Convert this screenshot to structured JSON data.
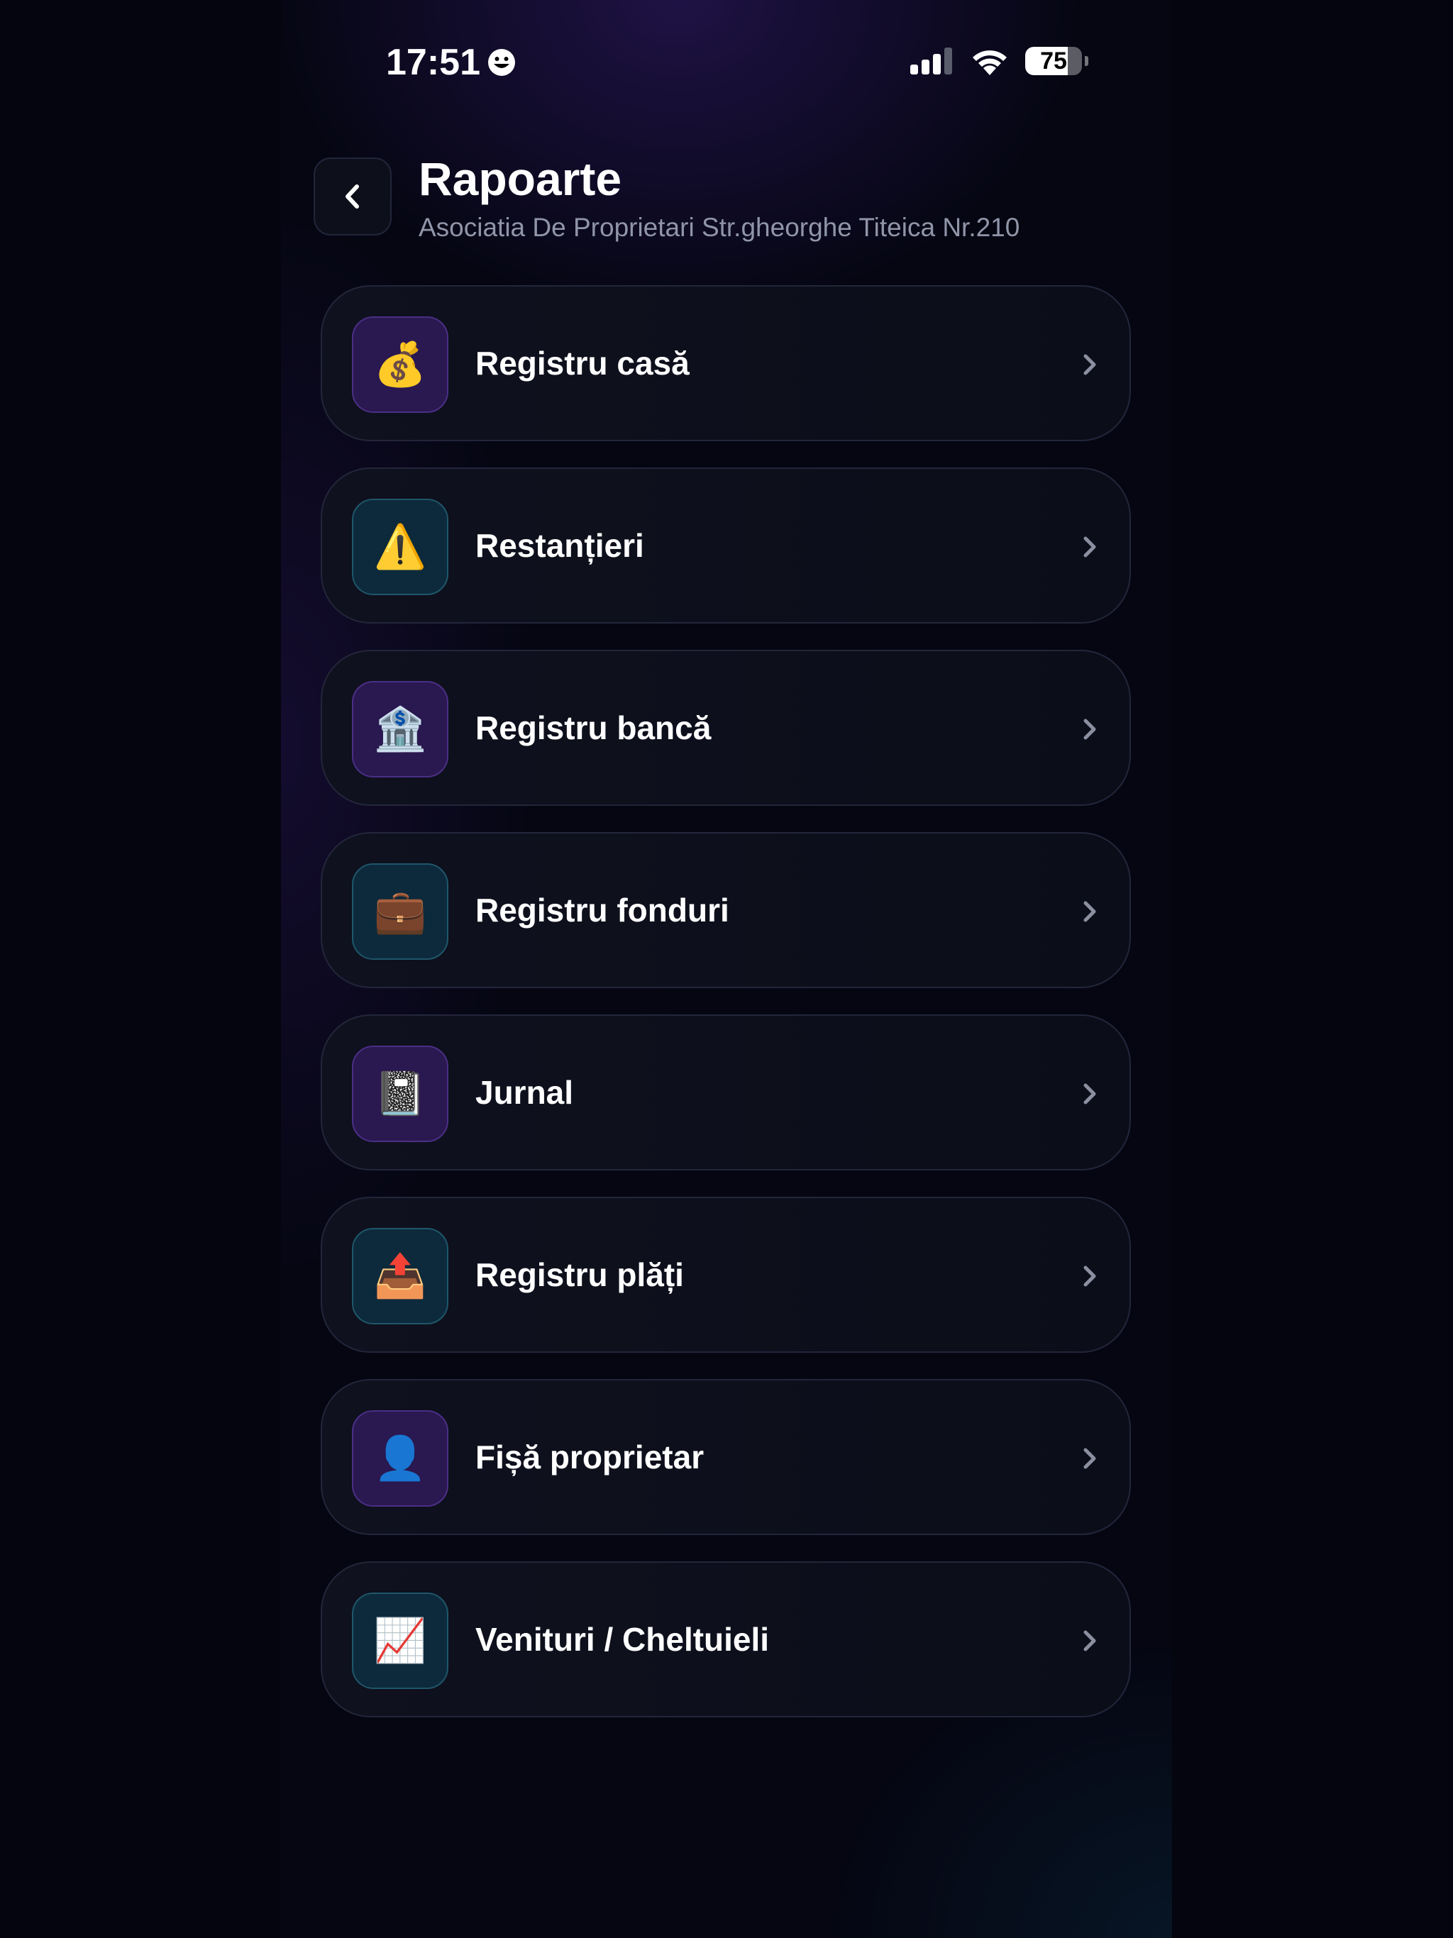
{
  "status_bar": {
    "time": "17:51",
    "battery_percent": "75",
    "battery_level": 0.75,
    "icons": [
      "smiley-face-icon",
      "cellular-signal-icon",
      "wifi-icon",
      "battery-icon"
    ]
  },
  "header": {
    "title": "Rapoarte",
    "subtitle": "Asociatia De Proprietari Str.gheorghe Titeica Nr.210",
    "back_icon": "chevron-left-icon"
  },
  "colors": {
    "background": "#050612",
    "card": "#0f111e",
    "card_border": "#23263a",
    "icon_purple_bg": "#2a1850",
    "icon_teal_bg": "#0d2a3c",
    "subtitle_text": "#9095a8",
    "chevron": "#8b8fa0"
  },
  "menu": {
    "items": [
      {
        "label": "Registru casă",
        "icon": "money-bag-icon",
        "glyph": "💰",
        "tint": "purple"
      },
      {
        "label": "Restanțieri",
        "icon": "warning-icon",
        "glyph": "⚠️",
        "tint": "teal"
      },
      {
        "label": "Registru bancă",
        "icon": "bank-icon",
        "glyph": "🏦",
        "tint": "purple"
      },
      {
        "label": "Registru fonduri",
        "icon": "briefcase-icon",
        "glyph": "💼",
        "tint": "teal"
      },
      {
        "label": "Jurnal",
        "icon": "notebook-icon",
        "glyph": "📓",
        "tint": "purple"
      },
      {
        "label": "Registru plăți",
        "icon": "outbox-tray-icon",
        "glyph": "📤",
        "tint": "teal"
      },
      {
        "label": "Fișă proprietar",
        "icon": "person-silhouette-icon",
        "glyph": "👤",
        "tint": "purple"
      },
      {
        "label": "Venituri / Cheltuieli",
        "icon": "chart-increasing-icon",
        "glyph": "📈",
        "tint": "teal"
      }
    ]
  }
}
